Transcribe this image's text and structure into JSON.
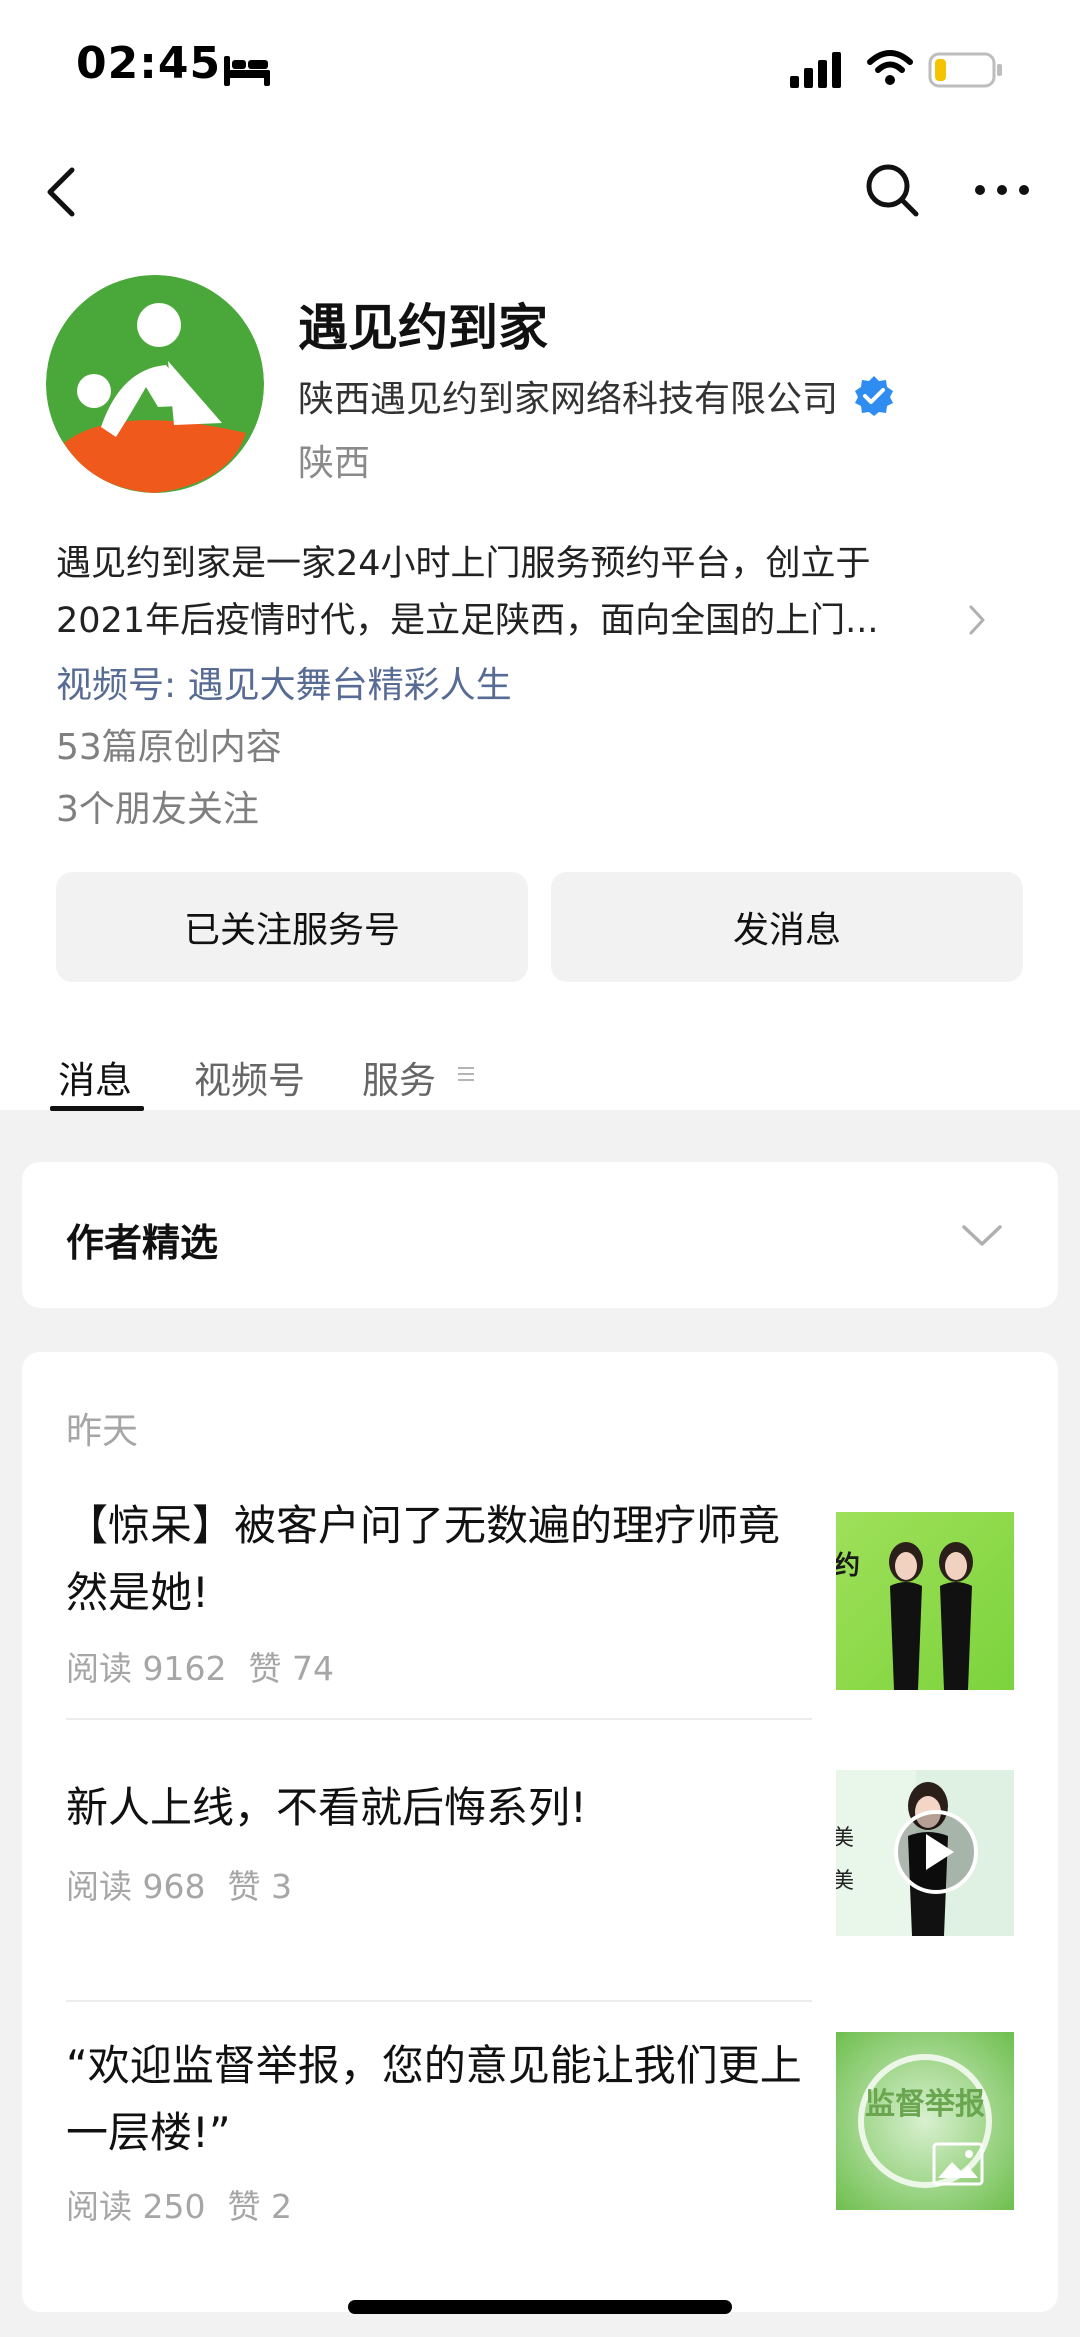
{
  "status_bar": {
    "time": "02:45",
    "icons": [
      "bed-icon",
      "signal-icon",
      "wifi-icon",
      "battery-icon"
    ],
    "battery_level": 0.2
  },
  "nav": {
    "icons": [
      "back-icon",
      "search-icon",
      "more-icon"
    ]
  },
  "profile": {
    "name": "遇见约到家",
    "company": "陕西遇见约到家网络科技有限公司",
    "region": "陕西",
    "intro_line1": "遇见约到家是一家24小时上门服务预约平台，创立于",
    "intro_line2": "2021年后疫情时代，是立足陕西，面向全国的上门...",
    "channel": "视频号: 遇见大舞台精彩人生",
    "original_count": "53篇原创内容",
    "friends_following": "3个朋友关注",
    "colors": {
      "logo_green": "#4aa83a",
      "logo_orange": "#ef5a1c",
      "verified_blue": "#2f8cf0",
      "link": "#576b95"
    }
  },
  "actions": {
    "follow_label": "已关注服务号",
    "message_label": "发消息"
  },
  "tabs": {
    "items": [
      {
        "label": "消息",
        "active": true
      },
      {
        "label": "视频号",
        "active": false
      },
      {
        "label": "服务",
        "active": false
      }
    ]
  },
  "featured": {
    "title": "作者精选"
  },
  "articles": {
    "date_label": "昨天",
    "items": [
      {
        "title": "【惊呆】被客户问了无数遍的理疗师竟然是她!",
        "reads": "阅读 9162",
        "likes": "赞 74",
        "thumb_text": "约"
      },
      {
        "title": "新人上线，不看就后悔系列!",
        "reads": "阅读 968",
        "likes": "赞 3",
        "thumb_text": "美"
      },
      {
        "title": "“欢迎监督举报，您的意见能让我们更上一层楼!”",
        "reads": "阅读 250",
        "likes": "赞 2",
        "thumb_text": "监督举报"
      }
    ]
  }
}
